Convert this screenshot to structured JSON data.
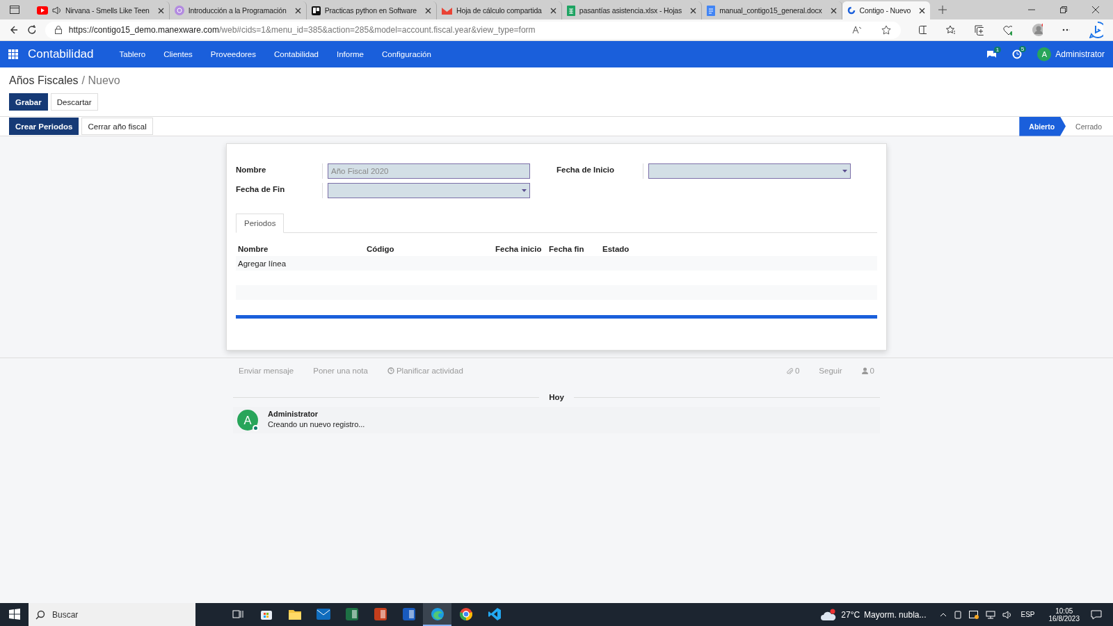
{
  "browser": {
    "tabs": [
      {
        "title": "Nirvana - Smells Like Teen",
        "muted": true,
        "selected": false
      },
      {
        "title": "Introducción a la Programación",
        "muted": false,
        "selected": false
      },
      {
        "title": "Practicas python en Software",
        "muted": false,
        "selected": false
      },
      {
        "title": "Hoja de cálculo compartida",
        "muted": false,
        "selected": false
      },
      {
        "title": "pasantías asistencia.xlsx - Hojas",
        "muted": false,
        "selected": false
      },
      {
        "title": "manual_contigo15_general.docx",
        "muted": false,
        "selected": false
      },
      {
        "title": "Contigo - Nuevo",
        "muted": false,
        "selected": true
      }
    ],
    "url_host": "https://contigo15_demo.manexware.com",
    "url_path": "/web#cids=1&menu_id=385&action=285&model=account.fiscal.year&view_type=form"
  },
  "navbar": {
    "app": "Contabilidad",
    "menu": [
      "Tablero",
      "Clientes",
      "Proveedores",
      "Contabilidad",
      "Informe",
      "Configuración"
    ],
    "messages_count": "1",
    "activities_count": "5",
    "user_initial": "A",
    "user": "Administrator"
  },
  "breadcrumb": {
    "parent": "Años Fiscales",
    "current": "/ Nuevo"
  },
  "form_buttons": [
    {
      "label": "Grabar",
      "primary": true
    },
    {
      "label": "Descartar",
      "primary": false
    }
  ],
  "header_buttons": [
    {
      "label": "Crear Periodos",
      "primary": true
    },
    {
      "label": "Cerrar año fiscal",
      "primary": false
    }
  ],
  "statusbar": [
    {
      "label": "Abierto",
      "selected": true
    },
    {
      "label": "Cerrado",
      "selected": false
    }
  ],
  "fields_left": [
    {
      "label": "Nombre",
      "kind": "text",
      "placeholder": "Año Fiscal 2020"
    },
    {
      "label": "Fecha de Fin",
      "kind": "date"
    }
  ],
  "fields_right": [
    {
      "label": "Fecha de Inicio",
      "kind": "date"
    }
  ],
  "notebook": {
    "tabs": [
      {
        "label": "Periodos",
        "selected": true
      }
    ],
    "columns": [
      "Nombre",
      "Código",
      "Fecha inicio",
      "Fecha fin",
      "Estado"
    ],
    "add_line": "Agregar línea"
  },
  "chatter": {
    "actions": [
      "Enviar mensaje",
      "Poner una nota",
      "Planificar actividad"
    ],
    "attachments": "0",
    "follow": "Seguir",
    "followers": "0",
    "date_separator": "Hoy",
    "messages": [
      {
        "initial": "A",
        "author": "Administrator",
        "body": "Creando un nuevo registro..."
      }
    ]
  },
  "taskbar": {
    "search": "Buscar",
    "apps": [
      {
        "selected": false
      },
      {
        "selected": false
      },
      {
        "selected": false
      },
      {
        "selected": false
      },
      {
        "selected": false
      },
      {
        "selected": false
      },
      {
        "selected": false
      },
      {
        "selected": true
      },
      {
        "selected": false
      },
      {
        "selected": false
      }
    ],
    "temperature": "27°C",
    "weather": "Mayorm. nubla...",
    "language": "ESP",
    "time": "10:05",
    "date": "16/8/2023"
  }
}
